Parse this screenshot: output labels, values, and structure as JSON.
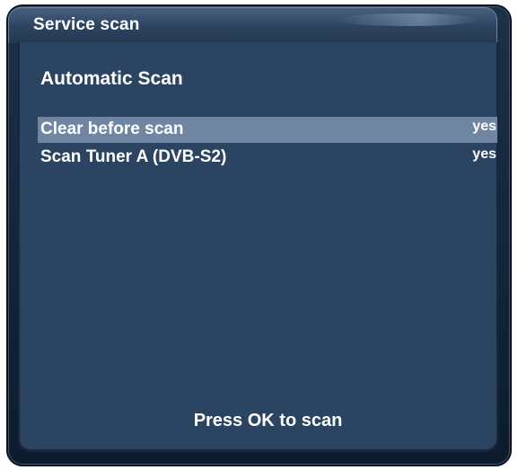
{
  "window": {
    "title": "Service scan"
  },
  "main": {
    "heading": "Automatic Scan",
    "options": [
      {
        "label": "Clear before scan",
        "value": "yes",
        "selected": true
      },
      {
        "label": "Scan Tuner A (DVB-S2)",
        "value": "yes",
        "selected": false
      }
    ],
    "footer_hint": "Press OK to scan"
  },
  "colors": {
    "background": "#2b4461",
    "selection": "#6f86a3",
    "text": "#ffffff",
    "frame": "#0d1b2c"
  }
}
